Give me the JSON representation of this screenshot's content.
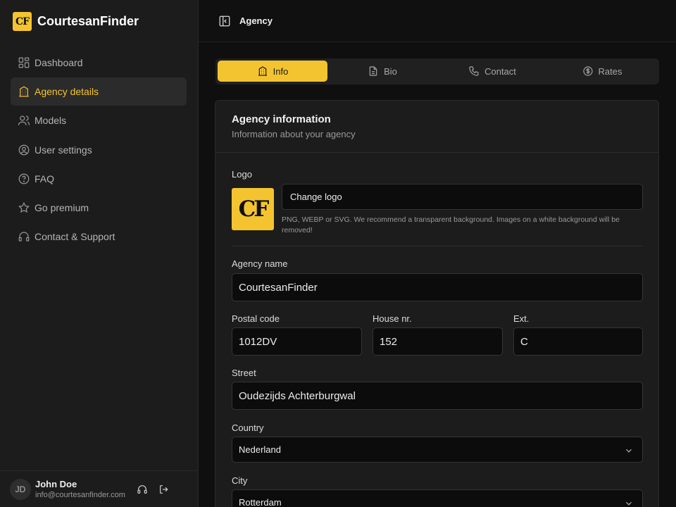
{
  "brand": {
    "logo_text": "CF",
    "name": "CourtesanFinder",
    "accent": "#f4c430"
  },
  "sidebar": {
    "items": [
      {
        "label": "Dashboard",
        "icon": "dashboard-icon"
      },
      {
        "label": "Agency details",
        "icon": "building-icon",
        "active": true
      },
      {
        "label": "Models",
        "icon": "users-icon"
      },
      {
        "label": "User settings",
        "icon": "user-circle-icon"
      },
      {
        "label": "FAQ",
        "icon": "help-circle-icon"
      },
      {
        "label": "Go premium",
        "icon": "star-icon"
      },
      {
        "label": "Contact & Support",
        "icon": "headset-icon"
      }
    ]
  },
  "user": {
    "initials": "JD",
    "name": "John Doe",
    "email": "info@courtesanfinder.com"
  },
  "topbar": {
    "title": "Agency"
  },
  "tabs": [
    {
      "label": "Info",
      "icon": "building-icon",
      "active": true
    },
    {
      "label": "Bio",
      "icon": "document-icon"
    },
    {
      "label": "Contact",
      "icon": "phone-icon"
    },
    {
      "label": "Rates",
      "icon": "dollar-circle-icon"
    }
  ],
  "card": {
    "title": "Agency information",
    "subtitle": "Information about your agency"
  },
  "form": {
    "logo_label": "Logo",
    "logo_text": "CF",
    "change_logo_label": "Change logo",
    "logo_hint": "PNG, WEBP or SVG. We recommend a transparent background. Images on a white background will be removed!",
    "agency_name_label": "Agency name",
    "agency_name_value": "CourtesanFinder",
    "postal_code_label": "Postal code",
    "postal_code_value": "1012DV",
    "house_nr_label": "House nr.",
    "house_nr_value": "152",
    "ext_label": "Ext.",
    "ext_value": "C",
    "street_label": "Street",
    "street_value": "Oudezijds Achterburgwal",
    "country_label": "Country",
    "country_value": "Nederland",
    "city_label": "City",
    "city_value": "Rotterdam"
  }
}
